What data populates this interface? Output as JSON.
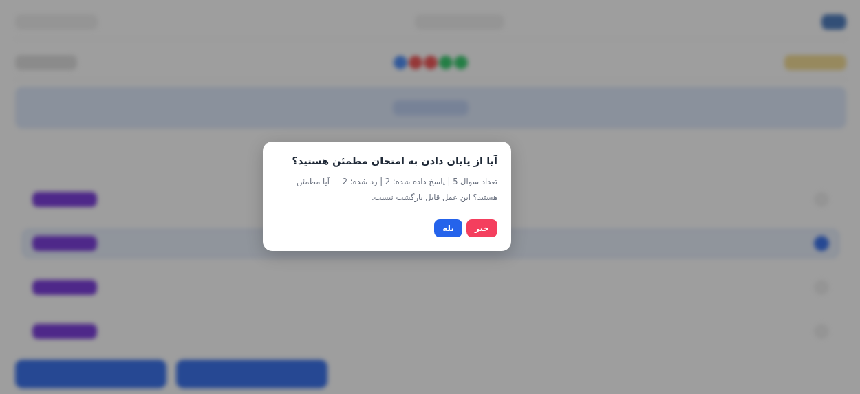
{
  "dialog": {
    "title": "آیا از پایان دادن به امتحان مطمئن هستید؟",
    "message": "تعداد سوال 5 | پاسخ داده شده: 2 | رد شده: 2 — آیا مطمئن هستید؟ این عمل قابل بازگشت نیست.",
    "buttons": [
      {
        "label": "خیر",
        "kind": "cancel"
      },
      {
        "label": "بله",
        "kind": "confirm"
      }
    ]
  }
}
